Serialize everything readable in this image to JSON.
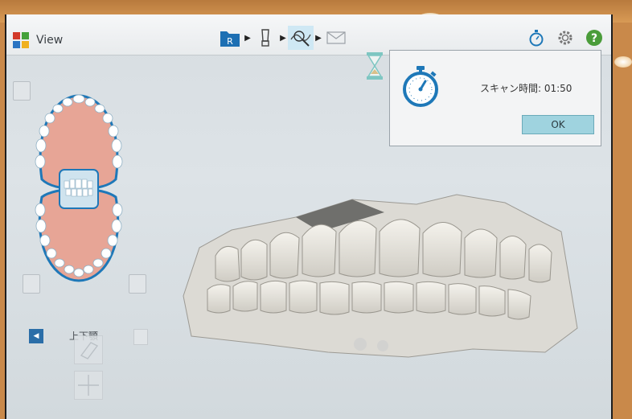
{
  "app": {
    "title": "View"
  },
  "workflow_steps": [
    {
      "name": "patient-step",
      "icon": "folder-r-icon",
      "glyph": "R",
      "active": false
    },
    {
      "name": "scan-step",
      "icon": "scanner-wand-icon",
      "active": false
    },
    {
      "name": "view-step",
      "icon": "view-magnifier-icon",
      "active": true
    },
    {
      "name": "send-step",
      "icon": "envelope-icon",
      "active": false
    }
  ],
  "toolbar_icons": [
    "stopwatch-icon",
    "gear-icon",
    "help-icon"
  ],
  "sidebar": {
    "jaw_label": "上下顎"
  },
  "dialog": {
    "message": "スキャン時間: 01:50",
    "ok_label": "OK",
    "icon": "stopwatch-icon"
  },
  "colors": {
    "accent_blue": "#1e78b8",
    "help_green": "#4a9c3a",
    "ok_button": "#9fd3df",
    "gum_pink": "#e7a596"
  }
}
